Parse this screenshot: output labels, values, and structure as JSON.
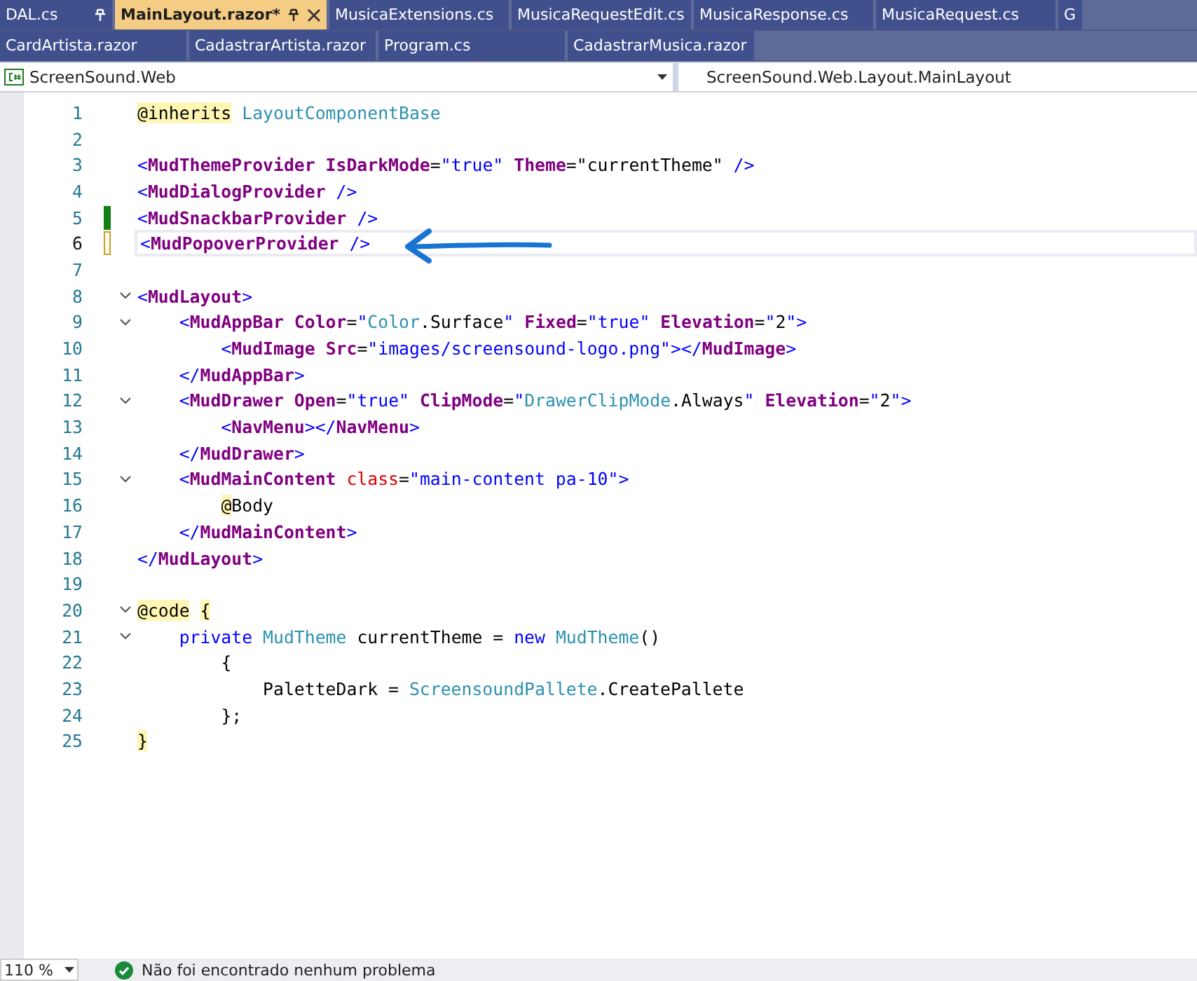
{
  "tabs": [
    {
      "label": "DAL.cs",
      "selected": false,
      "pinned": true
    },
    {
      "label": "MainLayout.razor*",
      "selected": true,
      "pinned": true
    },
    {
      "label": "MusicaExtensions.cs",
      "selected": false,
      "pinned": false
    },
    {
      "label": "MusicaRequestEdit.cs",
      "selected": false,
      "pinned": false
    },
    {
      "label": "MusicaResponse.cs",
      "selected": false,
      "pinned": false
    },
    {
      "label": "MusicaRequest.cs",
      "selected": false,
      "pinned": false
    },
    {
      "label": "G",
      "selected": false,
      "pinned": false
    }
  ],
  "tabs_row_2": [
    {
      "label": "CardArtista.razor",
      "selected": false
    },
    {
      "label": "CadastrarArtista.razor",
      "selected": false
    },
    {
      "label": "Program.cs",
      "selected": false
    },
    {
      "label": "CadastrarMusica.razor",
      "selected": false
    }
  ],
  "navigation_bar": {
    "project": "ScreenSound.Web",
    "member": "ScreenSound.Web.Layout.MainLayout"
  },
  "editor": {
    "lines": [
      {
        "number": "1",
        "selected": false,
        "foldable": false,
        "tokens": [
          {
            "kind": "razor",
            "text": "@inherits"
          },
          {
            "kind": "type",
            "text": " LayoutComponentBase"
          }
        ]
      },
      {
        "number": "2",
        "selected": false,
        "foldable": false
      },
      {
        "number": "3",
        "selected": false,
        "foldable": false,
        "tokens": [
          {
            "kind": "delim",
            "text": "<"
          },
          {
            "kind": "element",
            "text": "MudThemeProvider"
          },
          {
            "kind": "attr",
            "text": " IsDarkMode"
          },
          {
            "kind": "punct",
            "text": "="
          },
          {
            "kind": "string",
            "text": "\"true\""
          },
          {
            "kind": "attr",
            "text": " Theme"
          },
          {
            "kind": "punct",
            "text": "="
          },
          {
            "kind": "text",
            "text": "\"currentTheme\""
          },
          {
            "kind": "delim",
            "text": " />"
          }
        ]
      },
      {
        "number": "4",
        "selected": false,
        "foldable": false,
        "tokens": [
          {
            "kind": "delim",
            "text": "<"
          },
          {
            "kind": "element",
            "text": "MudDialogProvider"
          },
          {
            "kind": "delim",
            "text": " />"
          }
        ]
      },
      {
        "number": "5",
        "selected": false,
        "foldable": false,
        "change_marker": {
          "color": "#108010"
        },
        "tokens": [
          {
            "kind": "delim",
            "text": "<"
          },
          {
            "kind": "element",
            "text": "MudSnackbarProvider"
          },
          {
            "kind": "delim",
            "text": " />"
          }
        ]
      },
      {
        "number": "6",
        "selected": true,
        "foldable": false,
        "change_marker": {
          "color": "#c8a031"
        },
        "tokens": [
          {
            "kind": "delim",
            "text": "<"
          },
          {
            "kind": "element",
            "text": "MudPopoverProvider"
          },
          {
            "kind": "delim",
            "text": " />"
          }
        ]
      },
      {
        "number": "7",
        "selected": false,
        "foldable": false
      },
      {
        "number": "8",
        "selected": false,
        "foldable": true,
        "tokens": [
          {
            "kind": "delim",
            "text": "<"
          },
          {
            "kind": "element",
            "text": "MudLayout"
          },
          {
            "kind": "delim",
            "text": ">"
          }
        ]
      },
      {
        "number": "9",
        "selected": false,
        "foldable": true,
        "tokens": [
          {
            "kind": "delim",
            "text": "    <"
          },
          {
            "kind": "element",
            "text": "MudAppBar"
          },
          {
            "kind": "attr",
            "text": " Color"
          },
          {
            "kind": "punct",
            "text": "="
          },
          {
            "kind": "string",
            "text": "\""
          },
          {
            "kind": "type",
            "text": "Color"
          },
          {
            "kind": "text",
            "text": ".Surface"
          },
          {
            "kind": "string",
            "text": "\""
          },
          {
            "kind": "attr",
            "text": " Fixed"
          },
          {
            "kind": "punct",
            "text": "="
          },
          {
            "kind": "string",
            "text": "\"true\""
          },
          {
            "kind": "attr",
            "text": " Elevation"
          },
          {
            "kind": "punct",
            "text": "="
          },
          {
            "kind": "string",
            "text": "\""
          },
          {
            "kind": "text",
            "text": "2"
          },
          {
            "kind": "string",
            "text": "\""
          },
          {
            "kind": "delim",
            "text": ">"
          }
        ]
      },
      {
        "number": "10",
        "selected": false,
        "foldable": false,
        "tokens": [
          {
            "kind": "delim",
            "text": "        <"
          },
          {
            "kind": "element",
            "text": "MudImage"
          },
          {
            "kind": "attr",
            "text": " Src"
          },
          {
            "kind": "punct",
            "text": "="
          },
          {
            "kind": "string",
            "text": "\"images/screensound-logo.png\""
          },
          {
            "kind": "delim",
            "text": "></"
          },
          {
            "kind": "element",
            "text": "MudImage"
          },
          {
            "kind": "delim",
            "text": ">"
          }
        ]
      },
      {
        "number": "11",
        "selected": false,
        "foldable": false,
        "tokens": [
          {
            "kind": "delim",
            "text": "    </"
          },
          {
            "kind": "element",
            "text": "MudAppBar"
          },
          {
            "kind": "delim",
            "text": ">"
          }
        ]
      },
      {
        "number": "12",
        "selected": false,
        "foldable": true,
        "tokens": [
          {
            "kind": "delim",
            "text": "    <"
          },
          {
            "kind": "element",
            "text": "MudDrawer"
          },
          {
            "kind": "attr",
            "text": " Open"
          },
          {
            "kind": "punct",
            "text": "="
          },
          {
            "kind": "string",
            "text": "\"true\""
          },
          {
            "kind": "attr",
            "text": " ClipMode"
          },
          {
            "kind": "punct",
            "text": "="
          },
          {
            "kind": "string",
            "text": "\""
          },
          {
            "kind": "type",
            "text": "DrawerClipMode"
          },
          {
            "kind": "text",
            "text": ".Always"
          },
          {
            "kind": "string",
            "text": "\""
          },
          {
            "kind": "attr",
            "text": " Elevation"
          },
          {
            "kind": "punct",
            "text": "="
          },
          {
            "kind": "string",
            "text": "\""
          },
          {
            "kind": "text",
            "text": "2"
          },
          {
            "kind": "string",
            "text": "\""
          },
          {
            "kind": "delim",
            "text": ">"
          }
        ]
      },
      {
        "number": "13",
        "selected": false,
        "foldable": false,
        "tokens": [
          {
            "kind": "delim",
            "text": "        <"
          },
          {
            "kind": "element",
            "text": "NavMenu"
          },
          {
            "kind": "delim",
            "text": "></"
          },
          {
            "kind": "element",
            "text": "NavMenu"
          },
          {
            "kind": "delim",
            "text": ">"
          }
        ]
      },
      {
        "number": "14",
        "selected": false,
        "foldable": false,
        "tokens": [
          {
            "kind": "delim",
            "text": "    </"
          },
          {
            "kind": "element",
            "text": "MudDrawer"
          },
          {
            "kind": "delim",
            "text": ">"
          }
        ]
      },
      {
        "number": "15",
        "selected": false,
        "foldable": true,
        "tokens": [
          {
            "kind": "delim",
            "text": "    <"
          },
          {
            "kind": "element",
            "text": "MudMainContent"
          },
          {
            "kind": "cssattr",
            "text": " class"
          },
          {
            "kind": "punct",
            "text": "="
          },
          {
            "kind": "string",
            "text": "\"main-content pa-10\""
          },
          {
            "kind": "delim",
            "text": ">"
          }
        ]
      },
      {
        "number": "16",
        "selected": false,
        "foldable": false,
        "tokens": [
          {
            "kind": "razor",
            "text": "        @"
          },
          {
            "kind": "text",
            "text": "Body"
          }
        ]
      },
      {
        "number": "17",
        "selected": false,
        "foldable": false,
        "tokens": [
          {
            "kind": "delim",
            "text": "    </"
          },
          {
            "kind": "element",
            "text": "MudMainContent"
          },
          {
            "kind": "delim",
            "text": ">"
          }
        ]
      },
      {
        "number": "18",
        "selected": false,
        "foldable": false,
        "tokens": [
          {
            "kind": "delim",
            "text": "</"
          },
          {
            "kind": "element",
            "text": "MudLayout"
          },
          {
            "kind": "delim",
            "text": ">"
          }
        ]
      },
      {
        "number": "19",
        "selected": false,
        "foldable": false
      },
      {
        "number": "20",
        "selected": false,
        "foldable": true,
        "tokens": [
          {
            "kind": "razor",
            "text": "@code"
          },
          {
            "kind": "razor",
            "text": " {"
          }
        ]
      },
      {
        "number": "21",
        "selected": false,
        "foldable": true,
        "tokens": [
          {
            "kind": "keyword",
            "text": "    private"
          },
          {
            "kind": "type",
            "text": " MudTheme"
          },
          {
            "kind": "text",
            "text": " currentTheme = "
          },
          {
            "kind": "keyword",
            "text": "new"
          },
          {
            "kind": "type",
            "text": " MudTheme"
          },
          {
            "kind": "text",
            "text": "()"
          }
        ]
      },
      {
        "number": "22",
        "selected": false,
        "foldable": false,
        "tokens": [
          {
            "kind": "text",
            "text": "        {"
          }
        ]
      },
      {
        "number": "23",
        "selected": false,
        "foldable": false,
        "tokens": [
          {
            "kind": "text",
            "text": "            PaletteDark = "
          },
          {
            "kind": "type",
            "text": "ScreensoundPallete"
          },
          {
            "kind": "text",
            "text": ".CreatePallete"
          }
        ]
      },
      {
        "number": "24",
        "selected": false,
        "foldable": false,
        "tokens": [
          {
            "kind": "text",
            "text": "        };"
          }
        ]
      },
      {
        "number": "25",
        "selected": false,
        "foldable": false,
        "tokens": [
          {
            "kind": "razor",
            "text": "}"
          }
        ]
      }
    ]
  },
  "status_bar": {
    "zoom": "110 %",
    "message": "Não foi encontrado nenhum problema"
  }
}
